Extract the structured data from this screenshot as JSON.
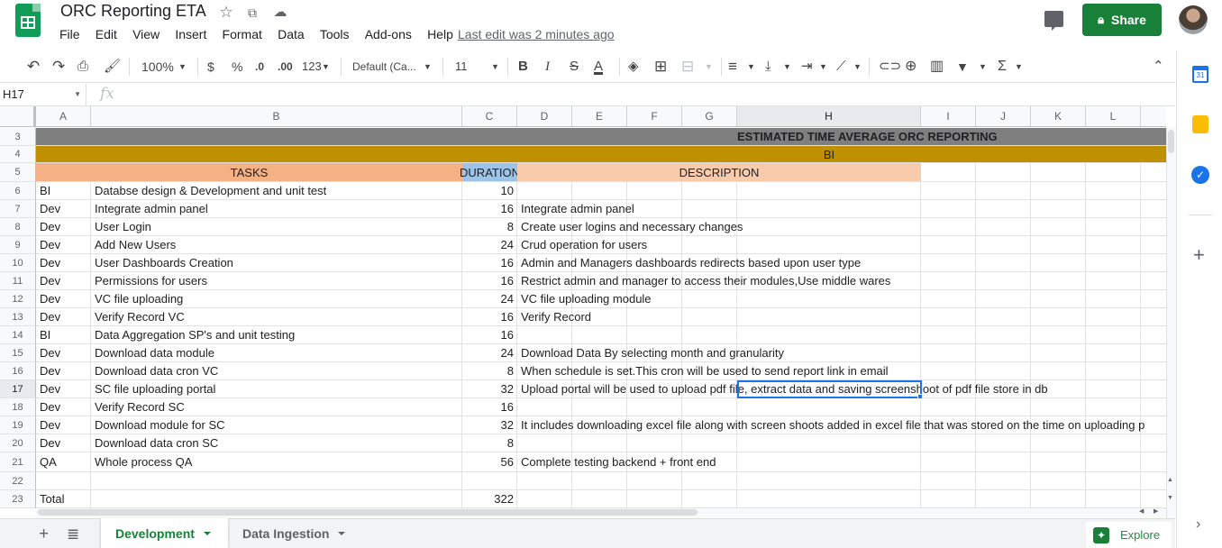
{
  "app": {
    "doc_title": "ORC Reporting ETA",
    "menu": [
      "File",
      "Edit",
      "View",
      "Insert",
      "Format",
      "Data",
      "Tools",
      "Add-ons",
      "Help"
    ],
    "last_edit": "Last edit was 2 minutes ago",
    "share_label": "Share"
  },
  "toolbar": {
    "zoom": "100%",
    "currency": "$",
    "percent": "%",
    "dec_decrease": ".0",
    "dec_increase": ".00",
    "more_formats": "123",
    "font": "Default (Ca...",
    "font_size": "11",
    "bold": "B",
    "italic": "I",
    "strike": "S",
    "text_color": "A",
    "sum": "Σ"
  },
  "formula_bar": {
    "name_box": "H17",
    "fx": "fx"
  },
  "columns": [
    "A",
    "B",
    "C",
    "D",
    "E",
    "F",
    "G",
    "H",
    "I",
    "J",
    "K",
    "L"
  ],
  "selected_column": "H",
  "selected_row": "17",
  "rows": [
    "3",
    "4",
    "5",
    "6",
    "7",
    "8",
    "9",
    "10",
    "11",
    "12",
    "13",
    "14",
    "15",
    "16",
    "17",
    "18",
    "19",
    "20",
    "21",
    "22",
    "23"
  ],
  "sheet": {
    "title": "ESTIMATED TIME AVERAGE ORC REPORTING",
    "subtitle": "BI",
    "headers": {
      "tasks": "TASKS",
      "duration": "DURATION",
      "description": "DESCRIPTION"
    },
    "data": [
      {
        "team": "BI",
        "task": "Databse design & Development and unit test",
        "duration": "10",
        "description": ""
      },
      {
        "team": "Dev",
        "task": "Integrate admin panel",
        "duration": "16",
        "description": "Integrate admin panel"
      },
      {
        "team": "Dev",
        "task": "User Login",
        "duration": "8",
        "description": "Create user logins and necessary changes"
      },
      {
        "team": "Dev",
        "task": "Add New Users",
        "duration": "24",
        "description": "Crud operation for users"
      },
      {
        "team": "Dev",
        "task": "User Dashboards Creation",
        "duration": "16",
        "description": "Admin and Managers dashboards redirects based upon user type"
      },
      {
        "team": "Dev",
        "task": "Permissions for users",
        "duration": "16",
        "description": "Restrict admin and manager to access their modules,Use middle wares"
      },
      {
        "team": "Dev",
        "task": "VC file uploading",
        "duration": "24",
        "description": "VC file uploading module"
      },
      {
        "team": "Dev",
        "task": "Verify Record VC",
        "duration": "16",
        "description": "Verify Record"
      },
      {
        "team": "BI",
        "task": "Data Aggregation SP's and unit testing",
        "duration": "16",
        "description": ""
      },
      {
        "team": "Dev",
        "task": "Download data module",
        "duration": "24",
        "description": "Download Data By selecting month and granularity"
      },
      {
        "team": "Dev",
        "task": "Download data cron VC",
        "duration": "8",
        "description": "When schedule is set.This cron will be used to send report link in email"
      },
      {
        "team": "Dev",
        "task": "SC file uploading portal",
        "duration": "32",
        "description": "Upload portal will be used to upload pdf file, extract data and saving screenshoot of pdf file  store in db"
      },
      {
        "team": "Dev",
        "task": "Verify Record SC",
        "duration": "16",
        "description": ""
      },
      {
        "team": "Dev",
        "task": "Download module for SC",
        "duration": "32",
        "description": "It includes downloading excel file along with screen shoots added in excel file that was stored on the time on uploading p"
      },
      {
        "team": "Dev",
        "task": "Download data cron SC",
        "duration": "8",
        "description": ""
      },
      {
        "team": "QA",
        "task": "Whole process QA",
        "duration": "56",
        "description": "Complete testing backend + front end"
      },
      {
        "team": "",
        "task": "",
        "duration": "",
        "description": ""
      },
      {
        "team": "Total",
        "task": "",
        "duration": "322",
        "description": ""
      }
    ]
  },
  "tabs": {
    "active": "Development",
    "other": "Data Ingestion"
  },
  "explore_label": "Explore",
  "colors": {
    "title_band": "#7f7f7f",
    "bi_band": "#bf9000",
    "tasks_header": "#f4b183",
    "duration_header": "#9dc3e6",
    "description_header": "#f8cbad",
    "accent_green": "#188038",
    "selection_blue": "#1a73e8"
  }
}
